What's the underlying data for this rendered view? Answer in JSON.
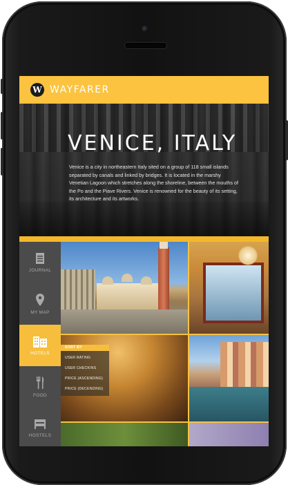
{
  "app": {
    "name": "WAYFARER",
    "logo_letter": "W"
  },
  "hero": {
    "title": "VENICE, ITALY",
    "description": "Venice is a city in northeastern Italy sited on a group of 118 small islands separated by canals and linked by bridges. It is located in the marshy Venetian Lagoon which stretches along the shoreline, between the mouths of the Po and the Piave Rivers. Venice is renowned for the beauty of its setting, its architecture and its artworks."
  },
  "nav": {
    "items": [
      {
        "label": "JOURNAL",
        "icon": "journal-icon",
        "active": false
      },
      {
        "label": "MY MAP",
        "icon": "map-pin-icon",
        "active": false
      },
      {
        "label": "HOTELS",
        "icon": "hotel-building-icon",
        "active": true
      },
      {
        "label": "FOOD",
        "icon": "fork-knife-icon",
        "active": false
      },
      {
        "label": "HOSTELS",
        "icon": "hostel-icon",
        "active": false
      }
    ]
  },
  "sort_menu": {
    "title": "SORT BY",
    "options": [
      "USER RATING",
      "USER CHECKINS",
      "PRICE (ASCENDING)",
      "PRICE (DECENDING)"
    ]
  },
  "colors": {
    "accent": "#fbc33f",
    "sidebar": "#4b4b4b",
    "phone": "#151515"
  }
}
